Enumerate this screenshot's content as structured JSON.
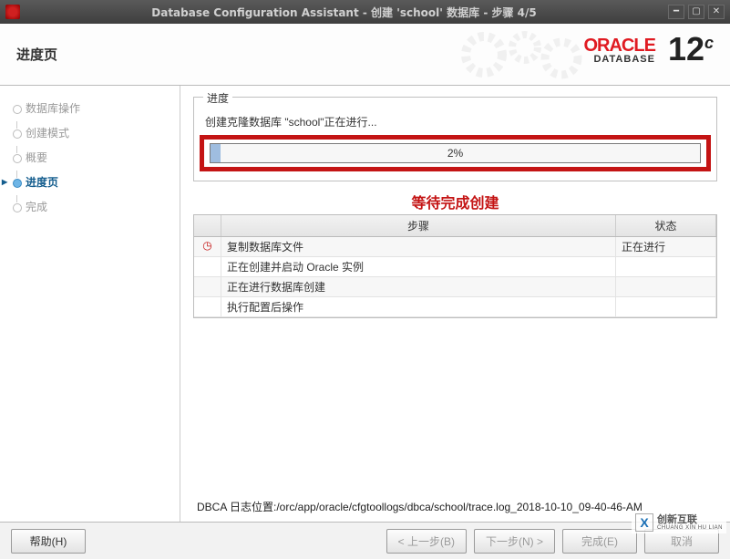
{
  "titlebar": {
    "title": "Database Configuration Assistant - 创建  'school' 数据库  -  步骤 4/5"
  },
  "header": {
    "page_title": "进度页",
    "brand": "ORACLE",
    "brand_sub": "DATABASE",
    "version": "12",
    "version_suffix": "c"
  },
  "sidebar": {
    "steps": [
      {
        "label": "数据库操作",
        "active": false
      },
      {
        "label": "创建模式",
        "active": false
      },
      {
        "label": "概要",
        "active": false
      },
      {
        "label": "进度页",
        "active": true
      },
      {
        "label": "完成",
        "active": false
      }
    ]
  },
  "main": {
    "group_title": "进度",
    "status_line": "创建克隆数据库 \"school\"正在进行...",
    "progress_percent": 2,
    "progress_text": "2%",
    "annotation": "等待完成创建",
    "table": {
      "col_step": "步骤",
      "col_state": "状态",
      "rows": [
        {
          "icon": "clock",
          "step": "复制数据库文件",
          "state": "正在进行"
        },
        {
          "icon": "",
          "step": "正在创建并启动 Oracle 实例",
          "state": ""
        },
        {
          "icon": "",
          "step": "正在进行数据库创建",
          "state": ""
        },
        {
          "icon": "",
          "step": "执行配置后操作",
          "state": ""
        }
      ]
    },
    "log_path": "DBCA 日志位置:/orc/app/oracle/cfgtoollogs/dbca/school/trace.log_2018-10-10_09-40-46-AM"
  },
  "footer": {
    "help": "帮助(H)",
    "back": "< 上一步(B)",
    "next": "下一步(N) >",
    "finish": "完成(E)",
    "cancel": "取消"
  },
  "watermark": {
    "text": "创新互联",
    "sub": "CHUANG XIN HU LIAN"
  }
}
